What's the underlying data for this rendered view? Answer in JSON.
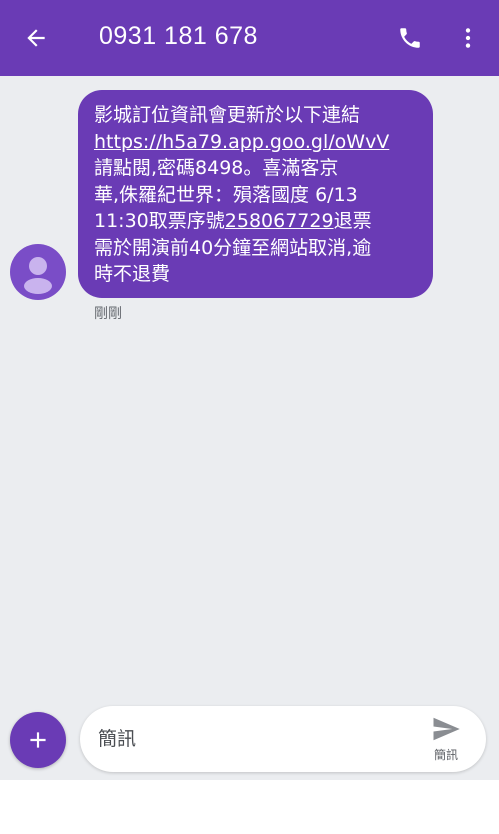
{
  "header": {
    "phone_number": "0931 181 678"
  },
  "message": {
    "lines": [
      "影城訂位資訊會更新於以下連結",
      "https://h5a79.app.goo.gl/oWvV",
      "請點閱,密碼8498。喜滿客京",
      "華,侏羅紀世界：殞落國度 6/13",
      "11:30取票序號",
      "258067729",
      "退票",
      "需於開演前40分鐘至網站取消,逾",
      "時不退費"
    ],
    "timestamp": "剛剛"
  },
  "composer": {
    "placeholder": "簡訊",
    "send_label": "簡訊"
  },
  "colors": {
    "accent": "#6a3bb5",
    "background": "#ebedf0"
  },
  "icons": {
    "back": "arrow-left-icon",
    "call": "phone-icon",
    "more": "more-vertical-icon",
    "avatar": "person-icon",
    "add": "plus-icon",
    "send": "send-icon"
  }
}
